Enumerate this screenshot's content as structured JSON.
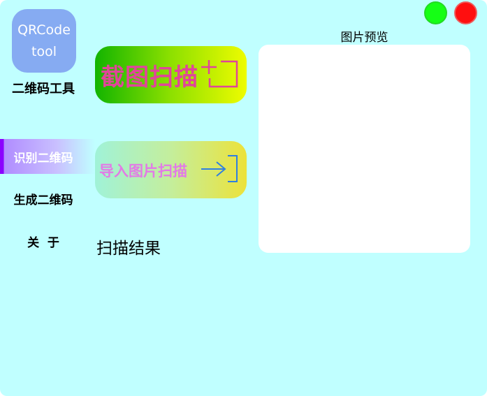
{
  "window": {
    "minimize_color": "#15ff15",
    "close_color": "#ff0f0f"
  },
  "logo": {
    "line1": "QRCode",
    "line2": "tool"
  },
  "app_name": "二维码工具",
  "nav": {
    "items": [
      {
        "label": "识别二维码",
        "active": true
      },
      {
        "label": "生成二维码",
        "active": false
      },
      {
        "label": "关  于",
        "active": false
      }
    ]
  },
  "actions": {
    "screenshot_scan_label": "截图扫描",
    "screenshot_icon": "crosshair-frame-icon",
    "import_scan_label": "导入图片扫描",
    "import_icon": "arrow-into-bracket-icon"
  },
  "result": {
    "label": "扫描结果"
  },
  "preview": {
    "title": "图片预览"
  },
  "colors": {
    "background": "#c0ffff",
    "logo_bg": "#86abf2",
    "active_nav": "#8b00ff",
    "screenshot_text": "#e0459a",
    "import_text": "#e27ae6",
    "import_icon": "#2f7fe0"
  }
}
